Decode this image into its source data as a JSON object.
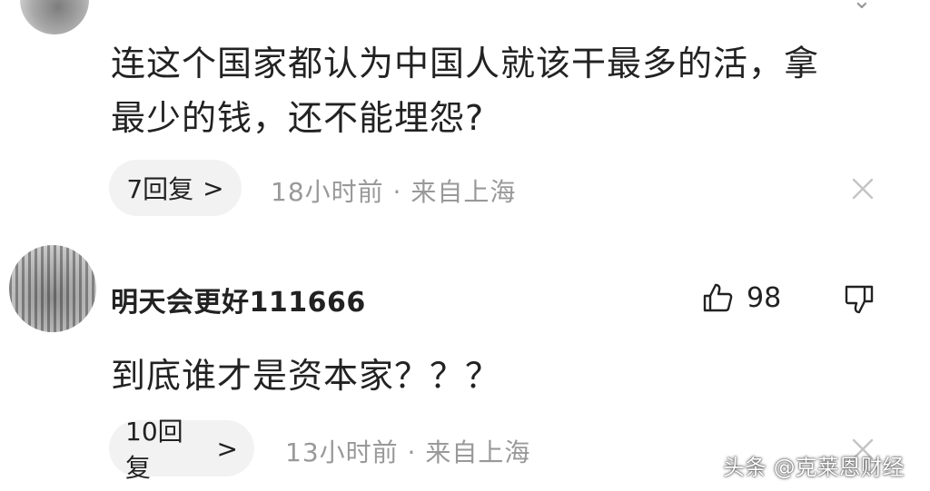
{
  "comment1": {
    "text_line1": "连这个国家都认为中国人就该干最多的活，拿",
    "text_line2": "最少的钱，还不能埋怨?",
    "reply_label": "7回复",
    "reply_chevron": ">",
    "meta": "18小时前 · 来自上海"
  },
  "comment2": {
    "username": "明天会更好111666",
    "like_count": "98",
    "text": "到底谁才是资本家？？？",
    "reply_label": "10回复",
    "reply_chevron": ">",
    "meta": "13小时前 · 来自上海"
  },
  "watermark": "头条 @克莱恩财经",
  "icons": {
    "like": "thumbs-up-icon",
    "dislike": "thumbs-down-icon",
    "close": "close-icon",
    "chevron": "chevron-right-icon"
  },
  "colors": {
    "text": "#222222",
    "meta": "#999999",
    "pill_bg": "#f2f2f2",
    "icon_gray": "#c4c4c4"
  }
}
